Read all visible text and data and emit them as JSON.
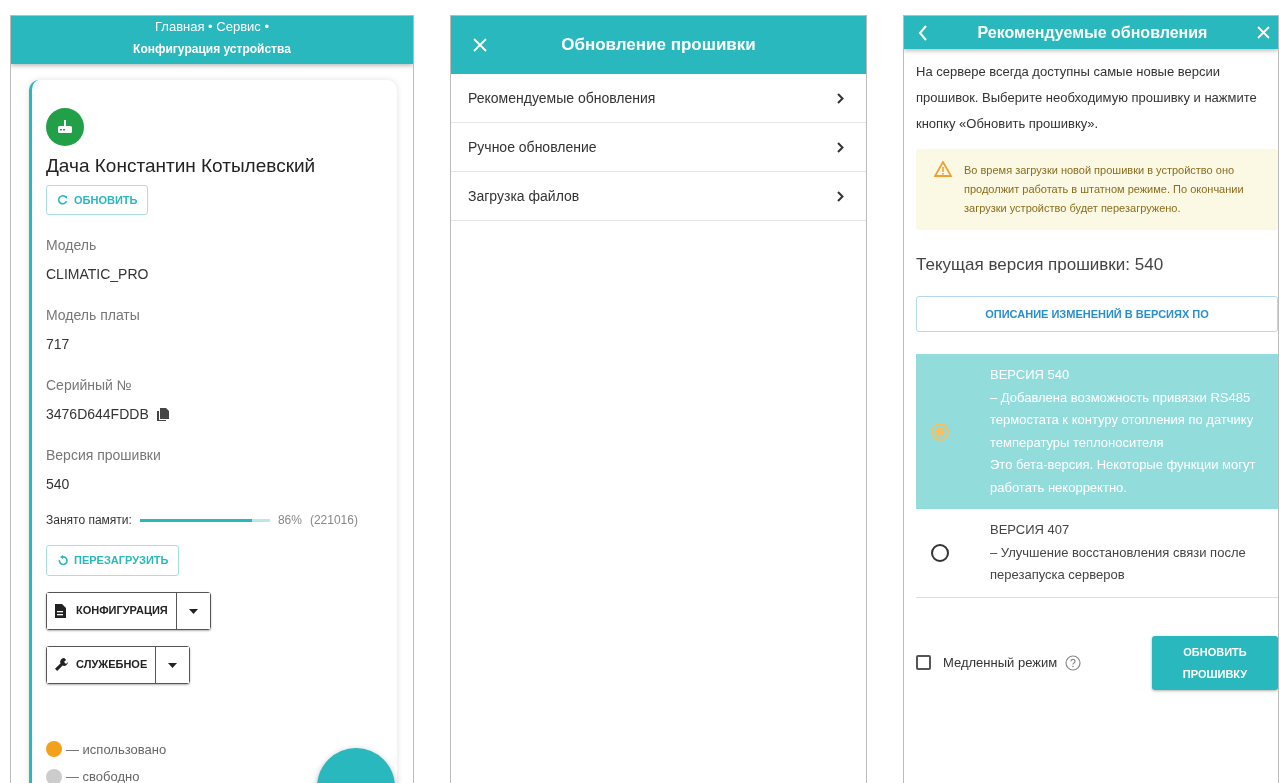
{
  "device_screen": {
    "breadcrumb": [
      "Главная • Сервис •",
      "Конфигурация устройства"
    ],
    "device_name": "Дача Константин Котылевский",
    "refresh_button": "ОБНОВИТЬ",
    "fields": [
      {
        "label": "Модель",
        "value": "CLIMATIC_PRO",
        "copyable": false
      },
      {
        "label": "Модель платы",
        "value": "717",
        "copyable": false
      },
      {
        "label": "Серийный №",
        "value": "3476D644FDDB",
        "copyable": true
      },
      {
        "label": "Версия прошивки",
        "value": "540",
        "copyable": false
      }
    ],
    "memory": {
      "label": "Занято памяти:",
      "level": 0.86,
      "percent": "86%",
      "count": "(221016)"
    },
    "reboot_button": "ПЕРЕЗАГРУЗИТЬ",
    "dropdown_buttons": [
      {
        "label": "КОНФИГУРАЦИЯ",
        "kind": "file"
      },
      {
        "label": "СЛУЖЕБНОЕ",
        "kind": "wrench"
      }
    ],
    "legend": [
      {
        "label": "— использовано",
        "color": "#f5a01a"
      },
      {
        "label": "— свободно",
        "color": "#cccccc"
      }
    ]
  },
  "firmware_menu": {
    "title": "Обновление прошивки",
    "items": [
      "Рекомендуемые обновления",
      "Ручное обновление",
      "Загрузка файлов"
    ]
  },
  "recommended_updates": {
    "title": "Рекомендуемые обновления",
    "intro": "На сервере всегда доступны самые новые версии прошивок. Выберите необходимую прошивку и нажмите кнопку «Обновить прошивку».",
    "warning": "Во время загрузки новой прошивки в устройство оно продолжит работать в штатном режиме. По окончании загрузки устройство будет перезагружено.",
    "current_version": "Текущая версия прошивки: 540",
    "changes_button": "ОПИСАНИЕ ИЗМЕНЕНИЙ В ВЕРСИЯХ ПО",
    "versions": [
      {
        "title": "ВЕРСИЯ 540",
        "description": "– Добавлена возможность привязки RS485 термостата к контуру отопления по датчику температуры теплоносителя",
        "note": "Это бета-версия. Некоторые функции могут работать некорректно.",
        "selected": true
      },
      {
        "title": "ВЕРСИЯ 407",
        "description": "– Улучшение восстановления связи после перезапуска серверов",
        "selected": false
      }
    ],
    "slow_mode": {
      "label": "Медленный режим",
      "checked": false
    },
    "update_button": "ОБНОВИТЬ ПРОШИВКУ"
  }
}
